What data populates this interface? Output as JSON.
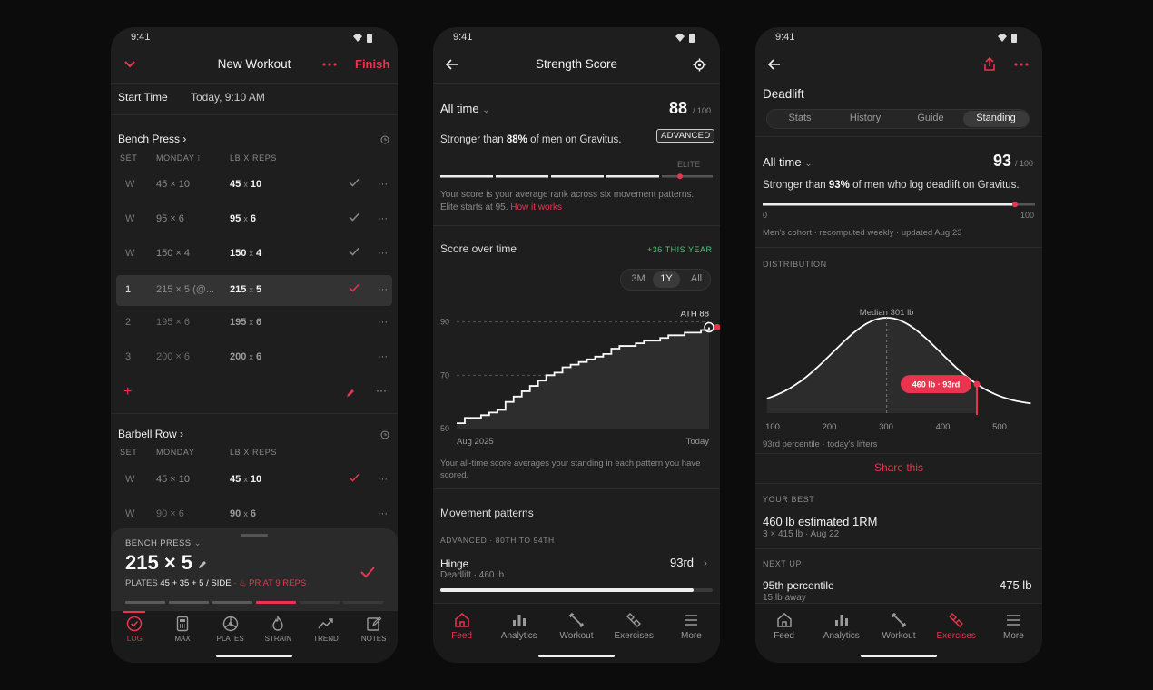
{
  "status_time": "9:41",
  "p1": {
    "title": "New Workout",
    "finish": "Finish",
    "start_label": "Start Time",
    "start_value": "Today, 9:10 AM",
    "ex1": {
      "name": "Bench Press ›",
      "col_set": "SET",
      "col_day": "MONDAY ⁝",
      "col_lbx": "LB X REPS",
      "rows": [
        {
          "set": "W",
          "prev": "45 × 10",
          "w": "45",
          "x": "x",
          "r": "10"
        },
        {
          "set": "W",
          "prev": "95 × 6",
          "w": "95",
          "x": "x",
          "r": "6"
        },
        {
          "set": "W",
          "prev": "150 × 4",
          "w": "150",
          "x": "x",
          "r": "4"
        },
        {
          "set": "1",
          "prev": "215 × 5 (@...",
          "w": "215",
          "x": "x",
          "r": "5"
        },
        {
          "set": "2",
          "prev": "195 × 6",
          "w": "195",
          "x": "x",
          "r": "6"
        },
        {
          "set": "3",
          "prev": "200 × 6",
          "w": "200",
          "x": "x",
          "r": "6"
        }
      ]
    },
    "ex2": {
      "name": "Barbell Row ›",
      "col_set": "SET",
      "col_day": "MONDAY",
      "col_lbx": "LB X REPS",
      "rows": [
        {
          "set": "W",
          "prev": "45 × 10",
          "w": "45",
          "x": "x",
          "r": "10"
        },
        {
          "set": "W",
          "prev": "90 × 6",
          "w": "90",
          "x": "x",
          "r": "6"
        }
      ]
    },
    "sheet": {
      "exercise": "BENCH PRESS",
      "big": "215 × 5",
      "plates_label": "PLATES",
      "plates": "45 + 35 + 5 / SIDE",
      "sep": "·",
      "pr": "PR AT 9 REPS",
      "progress_active_index": 3,
      "progress_total": 6
    },
    "tabs": [
      "LOG",
      "MAX",
      "PLATES",
      "STRAIN",
      "TREND",
      "NOTES"
    ]
  },
  "p2": {
    "title": "Strength Score",
    "range": "All time",
    "score": "88",
    "score_max": "/ 100",
    "level": "ADVANCED",
    "stronger_pre": "Stronger than ",
    "stronger_pct": "88%",
    "stronger_post": " of men on Gravitus.",
    "elite": "ELITE",
    "note": "Your score is your average rank across six movement patterns. Elite starts at 95.",
    "how": "How it works",
    "sot_title": "Score over time",
    "sot_delta": "+36 THIS YEAR",
    "periods": [
      "3M",
      "1Y",
      "All"
    ],
    "ath": "ATH 88",
    "x_start": "Aug 2025",
    "x_end": "Today",
    "footnote": "Your all-time score averages your standing in each pattern you have scored.",
    "mp_title": "Movement patterns",
    "mp_tier": "ADVANCED · 80TH TO 94TH",
    "hinge_name": "Hinge",
    "hinge_sub": "Deadlift · 460 lb",
    "hinge_rank": "93rd",
    "tabs": [
      "Feed",
      "Analytics",
      "Workout",
      "Exercises",
      "More"
    ]
  },
  "p3": {
    "title": "Deadlift",
    "segments": [
      "Stats",
      "History",
      "Guide",
      "Standing"
    ],
    "range": "All time",
    "score": "93",
    "score_max": "/ 100",
    "stronger_pre": "Stronger than ",
    "stronger_pct": "93%",
    "stronger_post": " of men who log deadlift on Gravitus.",
    "bar_min": "0",
    "bar_max": "100",
    "cohort": "Men's cohort · recomputed weekly · updated Aug 23",
    "dist_title": "DISTRIBUTION",
    "median": "Median 301 lb",
    "marker": "460 lb · 93rd",
    "dist_caption": "93rd percentile · today's lifters",
    "share": "Share this",
    "best_title": "YOUR BEST",
    "best_main": "460 lb estimated 1RM",
    "best_sub": "3 × 415 lb · Aug 22",
    "next_title": "NEXT UP",
    "next_main": "95th percentile",
    "next_val": "475 lb",
    "next_sub": "15 lb away",
    "tabs": [
      "Feed",
      "Analytics",
      "Workout",
      "Exercises",
      "More"
    ]
  },
  "chart_data": [
    {
      "type": "line",
      "title": "Score over time",
      "x_start_label": "Aug 2025",
      "x_end_label": "Today",
      "yticks": [
        50,
        70,
        90
      ],
      "ylim": [
        50,
        95
      ],
      "series": [
        {
          "values": [
            52,
            54,
            54,
            55,
            56,
            57,
            60,
            62,
            64,
            66,
            68,
            70,
            71,
            73,
            74,
            75,
            76,
            77,
            78,
            80,
            81,
            81,
            82,
            83,
            83,
            84,
            85,
            85,
            86,
            86,
            87,
            88
          ]
        }
      ],
      "annotation": "ATH 88"
    },
    {
      "type": "area",
      "title": "DISTRIBUTION",
      "xticks": [
        100,
        200,
        300,
        400,
        500
      ],
      "median": 301,
      "marker": 460,
      "marker_label": "460 lb · 93rd"
    }
  ],
  "colors": {
    "accent": "#e8344e",
    "bg": "#1e1e1e",
    "page": "#0c0c0c"
  }
}
